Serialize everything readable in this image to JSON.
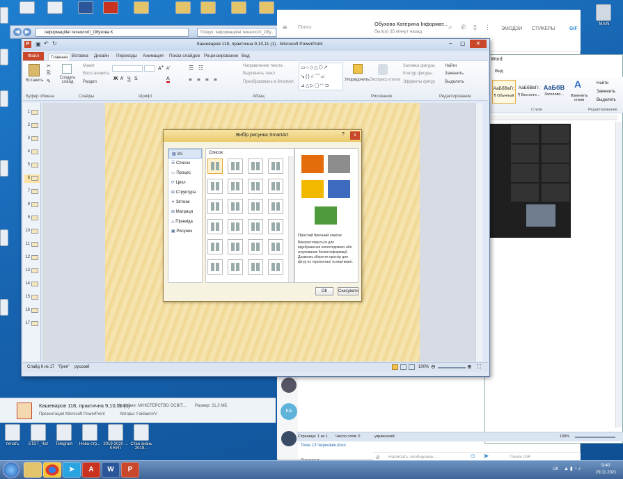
{
  "desktop_icons": [
    {
      "label": "печать"
    },
    {
      "label": "STDT_Чат"
    },
    {
      "label": "Telegram"
    },
    {
      "label": "Нова-стр..."
    },
    {
      "label": "2019-2020 ... КНУП"
    },
    {
      "label": "Стан знань 2019..."
    }
  ],
  "explorer": {
    "path": "Інформаційні технології_Обухова К",
    "search_placeholder": "Пошук: Інформаційні технології_Обу..."
  },
  "telegram": {
    "search": "Поиск",
    "contact": "Обухова Катерина Інформат...",
    "status": "был(а) 35 минут назад",
    "tab_emoji": "ЭМОДЗИ",
    "tab_stickers": "СТИКЕРЫ",
    "tab_gif": "GIF",
    "input_placeholder": "Написать сообщение...",
    "gif_search": "Поиск GIF",
    "chat_item": "Тема 13 Черновик.docx",
    "avatar_initials": "КА",
    "preview": "Документ"
  },
  "word": {
    "title": "Word",
    "tab": "Вид",
    "styles": [
      {
        "sample": "АаБбВвГг,",
        "label": "¶ Обычный"
      },
      {
        "sample": "АаБбВвГг,",
        "label": "¶ Без инте..."
      },
      {
        "sample": "АаБбВ",
        "label": "Заголово..."
      }
    ],
    "change_styles": "Изменить стили",
    "find": "Найти",
    "replace": "Заменить",
    "select": "Выделить",
    "group_styles": "Стили",
    "group_edit": "Редактирование",
    "status_page": "Страница: 1 из 1",
    "status_words": "Число слов: 0",
    "status_lang": "украинский",
    "zoom": "100%"
  },
  "ppt": {
    "title": "Кашеваров 118, практична 9,10,11 (1) - Microsoft PowerPoint",
    "file_tab": "Файл",
    "tabs": [
      "Главная",
      "Вставка",
      "Дизайн",
      "Переходы",
      "Анимация",
      "Показ слайдов",
      "Рецензирование",
      "Вид"
    ],
    "clipboard": {
      "paste": "Вставить",
      "group": "Буфер обмена"
    },
    "slides": {
      "new": "Создать слайд",
      "layout": "Макет",
      "reset": "Восстановить",
      "section": "Раздел",
      "group": "Слайды"
    },
    "font_group": "Шрифт",
    "para": {
      "direction": "Направление текста",
      "align": "Выровнять текст",
      "smartart": "Преобразовать в SmartArt",
      "group": "Абзац"
    },
    "drawing": {
      "arrange": "Упорядочить",
      "quick_styles": "Экспресс-стили",
      "fill": "Заливка фигуры",
      "outline": "Контур фигуры",
      "effects": "Эффекты фигур",
      "group": "Рисование"
    },
    "editing": {
      "find": "Найти",
      "replace": "Заменить",
      "select": "Выделить",
      "group": "Редактирование"
    },
    "slide_numbers": [
      "1",
      "2",
      "3",
      "4",
      "5",
      "6",
      "7",
      "8",
      "9",
      "10",
      "11",
      "12",
      "13",
      "14",
      "15",
      "16",
      "17"
    ],
    "status": {
      "slide": "Слайд 6 из 17",
      "theme": "\"Грек\"",
      "lang": "русский",
      "zoom": "100%"
    }
  },
  "dialog": {
    "title": "Вибір рисунка SmartArt",
    "help": "?",
    "close": "x",
    "list_header": "Список",
    "categories": [
      "Усі",
      "Список",
      "Процес",
      "Цикл",
      "Структура",
      "Зв'язок",
      "Матриця",
      "Піраміда",
      "Рисунок"
    ],
    "preview_title": "Простий блочний список",
    "preview_desc": "Використовується для відображення непослідовних або згрупованих блоків інформації. Дозволяє зберегти простір для фігур по горизонталі та вертикалі.",
    "ok": "ОК",
    "cancel": "Скасувати",
    "colors": {
      "orange": "#e46c0a",
      "gray": "#8c8c8c",
      "yellow": "#f2b800",
      "blue": "#3e6bbf",
      "green": "#4f9a3a"
    }
  },
  "file_info": {
    "name": "Кашеваров 118, практична 9,10,11 (1)",
    "type": "Презентация Microsoft PowerPoint",
    "title_label": "Название: МІНІСТЕРСТВО ОСВІТ...",
    "authors": "Авторы: FaidaenVV",
    "size": "Размер: 21,3 МБ"
  },
  "taskbar": {
    "lang": "UK",
    "time": "9:40",
    "date": "29.11.2021"
  },
  "video": {
    "tiles": [
      "",
      "В",
      "",
      "А",
      "",
      "",
      "",
      "А",
      "",
      "",
      ""
    ]
  }
}
